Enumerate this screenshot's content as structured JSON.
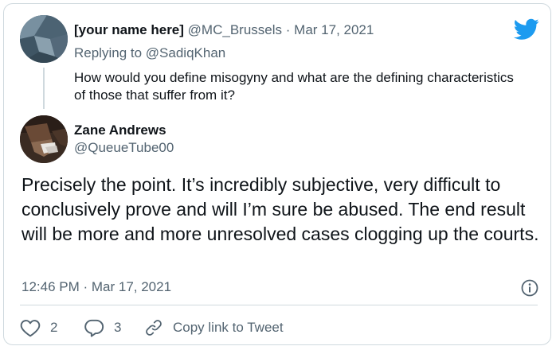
{
  "quoted_tweet": {
    "display_name": "[your name here]",
    "handle": "@MC_Brussels",
    "separator": "·",
    "date": "Mar 17, 2021",
    "replying_to_label": "Replying to",
    "replying_to_handle": "@SadiqKhan",
    "text": "How would you define misogyny and what are the defining characteristics of those that suffer from it?"
  },
  "tweet": {
    "display_name": "Zane Andrews",
    "handle": "@QueueTube00",
    "text": "Precisely the point. It’s incredibly subjective, very difficult to conclusively prove and will I’m sure be abused. The end result will be more and more unresolved cases clogging up the courts.",
    "timestamp": "12:46 PM · Mar 17, 2021"
  },
  "actions": {
    "like_count": "2",
    "reply_count": "3",
    "copy_link_label": "Copy link to Tweet"
  },
  "icons": {
    "brand": "twitter-bird-icon",
    "info": "info-icon",
    "like": "heart-icon",
    "reply": "reply-bubble-icon",
    "copy": "link-icon"
  },
  "colors": {
    "brand_blue": "#1d9bf0",
    "muted_text": "#536471",
    "border": "#cfd9de"
  }
}
